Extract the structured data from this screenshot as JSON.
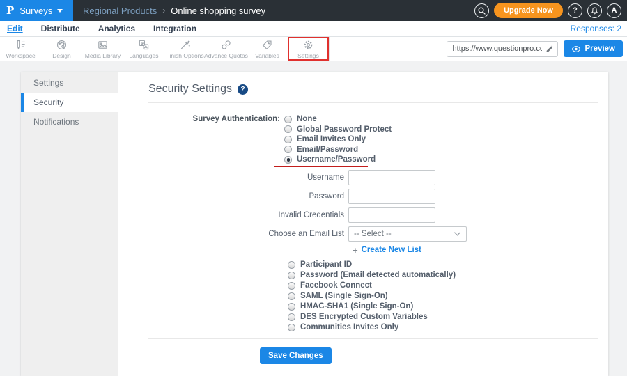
{
  "colors": {
    "accent_blue": "#1b87e6",
    "upgrade_orange": "#f7941e",
    "annotation_red": "#e0312e",
    "topbar_bg": "#2a3036"
  },
  "topbar": {
    "logo_text": "P",
    "product_menu": "Surveys",
    "breadcrumb_folder": "Regional Products",
    "breadcrumb_separator": "›",
    "breadcrumb_title": "Online shopping survey",
    "upgrade_label": "Upgrade Now",
    "help_label": "?",
    "avatar_label": "A"
  },
  "nav": {
    "items": [
      {
        "label": "Edit",
        "active": true
      },
      {
        "label": "Distribute"
      },
      {
        "label": "Analytics"
      },
      {
        "label": "Integration"
      }
    ],
    "responses": "Responses: 2"
  },
  "toolbar": {
    "items": [
      {
        "label": "Workspace",
        "icon": "workspace-icon"
      },
      {
        "label": "Design",
        "icon": "design-palette-icon"
      },
      {
        "label": "Media Library",
        "icon": "media-library-icon"
      },
      {
        "label": "Languages",
        "icon": "languages-icon"
      },
      {
        "label": "Finish Options",
        "icon": "magic-wand-icon"
      },
      {
        "label": "Advance Quotas",
        "icon": "chain-links-icon"
      },
      {
        "label": "Variables",
        "icon": "tag-icon"
      },
      {
        "label": "Settings",
        "icon": "settings-gear-icon",
        "highlighted": true
      }
    ],
    "url_value": "https://www.questionpro.com/t/APNrFZ",
    "preview_label": "Preview"
  },
  "sidebar": {
    "items": [
      {
        "label": "Settings"
      },
      {
        "label": "Security",
        "active": true
      },
      {
        "label": "Notifications"
      }
    ]
  },
  "main": {
    "title": "Security Settings",
    "help_badge": "?",
    "auth_label": "Survey Authentication:",
    "auth_options": [
      {
        "label": "None"
      },
      {
        "label": "Global Password Protect"
      },
      {
        "label": "Email Invites Only"
      },
      {
        "label": "Email/Password"
      },
      {
        "label": "Username/Password",
        "selected": true,
        "annotated": true
      }
    ],
    "fields": [
      {
        "label": "Username",
        "value": ""
      },
      {
        "label": "Password",
        "value": ""
      },
      {
        "label": "Invalid Credentials",
        "value": ""
      }
    ],
    "email_list_label": "Choose an Email List",
    "email_list_value": "-- Select --",
    "create_list_plus": "+",
    "create_list_label": "Create New List",
    "more_options": [
      {
        "label": "Participant ID"
      },
      {
        "label": "Password (Email detected automatically)"
      },
      {
        "label": "Facebook Connect"
      },
      {
        "label": "SAML (Single Sign-On)"
      },
      {
        "label": "HMAC-SHA1 (Single Sign-On)"
      },
      {
        "label": "DES Encrypted Custom Variables"
      },
      {
        "label": "Communities Invites Only"
      }
    ],
    "save_label": "Save Changes"
  }
}
